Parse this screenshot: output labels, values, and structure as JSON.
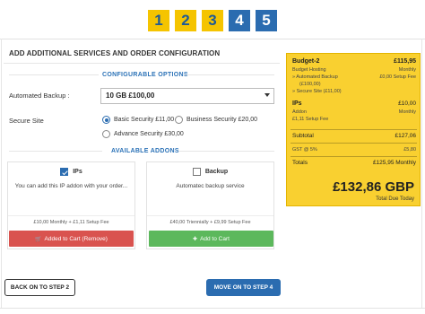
{
  "steps": [
    {
      "label": "1",
      "state": "done"
    },
    {
      "label": "2",
      "state": "done"
    },
    {
      "label": "3",
      "state": "done"
    },
    {
      "label": "4",
      "state": "todo"
    },
    {
      "label": "5",
      "state": "todo"
    }
  ],
  "page": {
    "title": "ADD ADDITIONAL SERVICES AND ORDER CONFIGURATION"
  },
  "config": {
    "heading": "CONFIGURABLE OPTIONS",
    "backup_label": "Automated Backup :",
    "backup_value": "10 GB £100,00",
    "secure_label": "Secure Site",
    "secure_options": [
      "Basic Security £11,00",
      "Business Security £20,00",
      "Advance Security £30,00"
    ],
    "secure_selected": "Basic Security £11,00"
  },
  "addons": {
    "heading": "AVAILABLE ADDONS",
    "items": [
      {
        "name": "IPs",
        "checked": true,
        "description": "You can add this IP addon with your order...",
        "price": "£10,00 Monthly + £1,11 Setup Fee",
        "button": "Added to Cart (Remove)",
        "button_icon": "cart-icon"
      },
      {
        "name": "Backup",
        "checked": false,
        "description": "Automatec backup service",
        "price": "£40,00 Triennially + £9,99 Setup Fee",
        "button": "Add to Cart",
        "button_icon": "plus-icon"
      }
    ]
  },
  "summary": {
    "product": "Budget-2",
    "product_price": "£115,95",
    "sub1": "Budget Hosting",
    "sub1_right": "Monthly",
    "sub2": "» Automated Backup",
    "sub2_right": "£0,00 Setup Fee",
    "sub3": "(£100,00)",
    "sub4": "» Secure Site (£11,00)",
    "addon": "IPs",
    "addon_price": "£10,00",
    "addon_sub1": "Addon",
    "addon_sub1_right": "Monthly",
    "addon_sub2": "£1,11 Setup Fee",
    "subtotal_label": "Subtotal",
    "subtotal": "£127,06",
    "gst_label": "GST @ 5%",
    "gst": "£5,80",
    "totals_label": "Totals",
    "totals": "£125,95 Monthly",
    "total_due": "£132,86 GBP",
    "total_due_label": "Total Due Today"
  },
  "nav": {
    "back": "BACK ON TO STEP 2",
    "next": "MOVE ON TO STEP 4"
  },
  "colors": {
    "accent": "#2b6cb0",
    "highlight": "#f5c400",
    "danger": "#d9534f",
    "success": "#5cb85c"
  }
}
